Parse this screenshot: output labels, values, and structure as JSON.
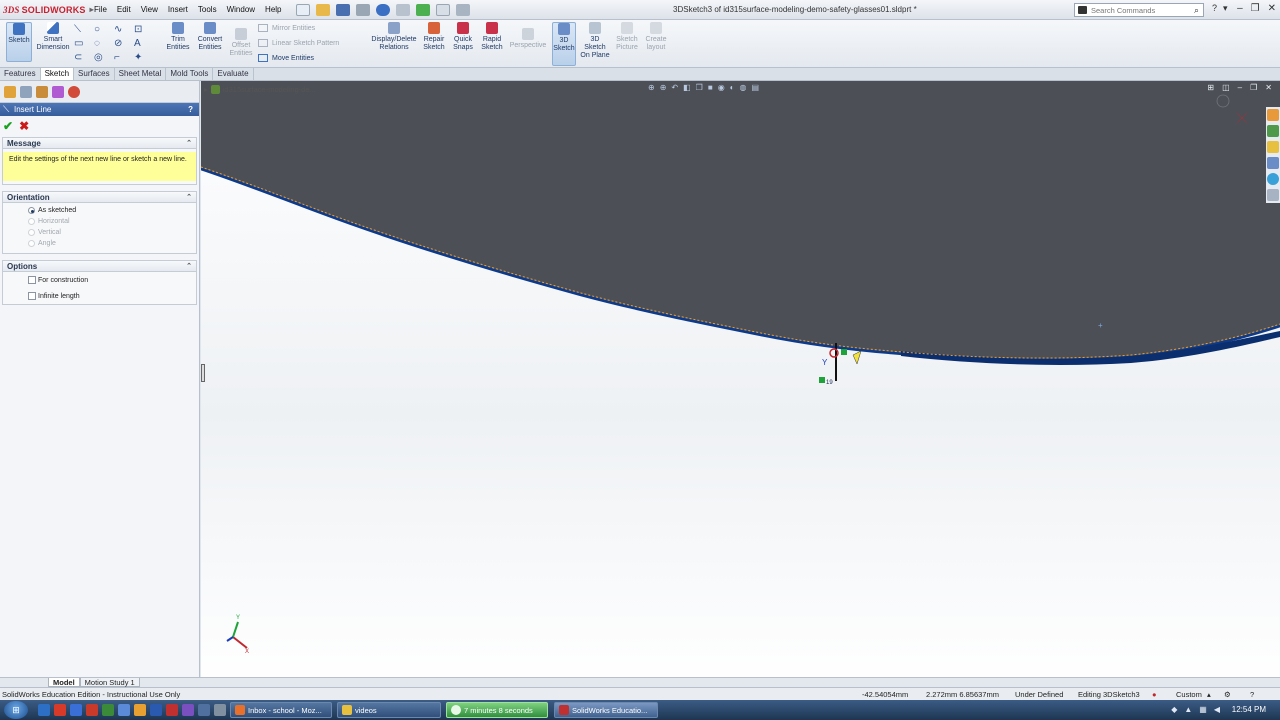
{
  "app": {
    "brand_prefix": "3DS",
    "brand_name": "SOLIDWORKS",
    "document_title": "3DSketch3 of id315surface-modeling-demo-safety-glasses01.sldprt *"
  },
  "menu": [
    "File",
    "Edit",
    "View",
    "Insert",
    "Tools",
    "Window",
    "Help"
  ],
  "search": {
    "placeholder": "Search Commands"
  },
  "toolbar": {
    "sketch": "Sketch",
    "smart_dimension": "Smart Dimension",
    "trim_entities": "Trim Entities",
    "convert_entities": "Convert Entities",
    "offset_entities": "Offset Entities",
    "mirror_entities": "Mirror Entities",
    "linear_sketch_pattern": "Linear Sketch Pattern",
    "move_entities": "Move Entities",
    "display_delete_relations": "Display/Delete Relations",
    "repair_sketch": "Repair Sketch",
    "quick_snaps": "Quick Snaps",
    "rapid_sketch": "Rapid Sketch",
    "perspective": "Perspective",
    "sketch_3d": "3D Sketch",
    "sketch_3d_on_plane": "3D Sketch On Plane",
    "sketch_picture": "Sketch Picture",
    "create_layout": "Create layout"
  },
  "tabs": [
    "Features",
    "Sketch",
    "Surfaces",
    "Sheet Metal",
    "Mold Tools",
    "Evaluate"
  ],
  "active_tab": "Sketch",
  "property_manager": {
    "title": "Insert Line",
    "help": "?",
    "message_header": "Message",
    "message_text": "Edit the settings of the next new line or sketch a new line.",
    "orientation_header": "Orientation",
    "orientation_options": [
      {
        "label": "As sketched",
        "selected": true,
        "enabled": true
      },
      {
        "label": "Horizontal",
        "selected": false,
        "enabled": false
      },
      {
        "label": "Vertical",
        "selected": false,
        "enabled": false
      },
      {
        "label": "Angle",
        "selected": false,
        "enabled": false
      }
    ],
    "options_header": "Options",
    "options": [
      {
        "label": "For construction",
        "checked": false
      },
      {
        "label": "Infinite length",
        "checked": false
      }
    ]
  },
  "viewport": {
    "tree_flyout": "id315surface-modeling-de...",
    "triad_x": "X",
    "triad_y": "Y",
    "snap_marker": "19"
  },
  "bottom_tabs": [
    "Model",
    "Motion Study 1"
  ],
  "active_bottom_tab": "Model",
  "status": {
    "edition": "SolidWorks Education Edition - Instructional Use Only",
    "x_coord": "-42.54054mm",
    "yz_coord": "2.272mm 6.85637mm",
    "definition": "Under Defined",
    "editing": "Editing 3DSketch3",
    "units": "Custom"
  },
  "taskbar": {
    "buttons": [
      "Inbox - school - Moz...",
      "videos",
      "7 minutes 8 seconds",
      "SolidWorks Educatio..."
    ],
    "clock": "12:54 PM"
  },
  "colors": {
    "accent_blue": "#365c9b",
    "surface_dark": "#4c4f55",
    "edge_blue": "#0d3a8a",
    "message_yellow": "#ffff99"
  }
}
